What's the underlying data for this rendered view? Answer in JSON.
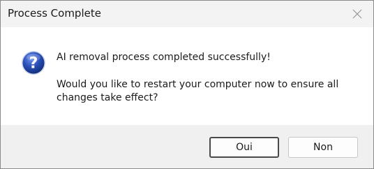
{
  "window": {
    "title": "Process Complete",
    "close_icon": "close-icon"
  },
  "message": {
    "icon": "question-icon",
    "line1": "AI removal process completed successfully!",
    "line2": "Would you like to restart your computer now to ensure all changes take effect?"
  },
  "buttons": {
    "yes_label": "Oui",
    "no_label": "Non"
  },
  "colors": {
    "icon_blue": "#2a4fb8",
    "titlebar_bg": "#f3f3f3",
    "footer_bg": "#f0f0f0"
  }
}
